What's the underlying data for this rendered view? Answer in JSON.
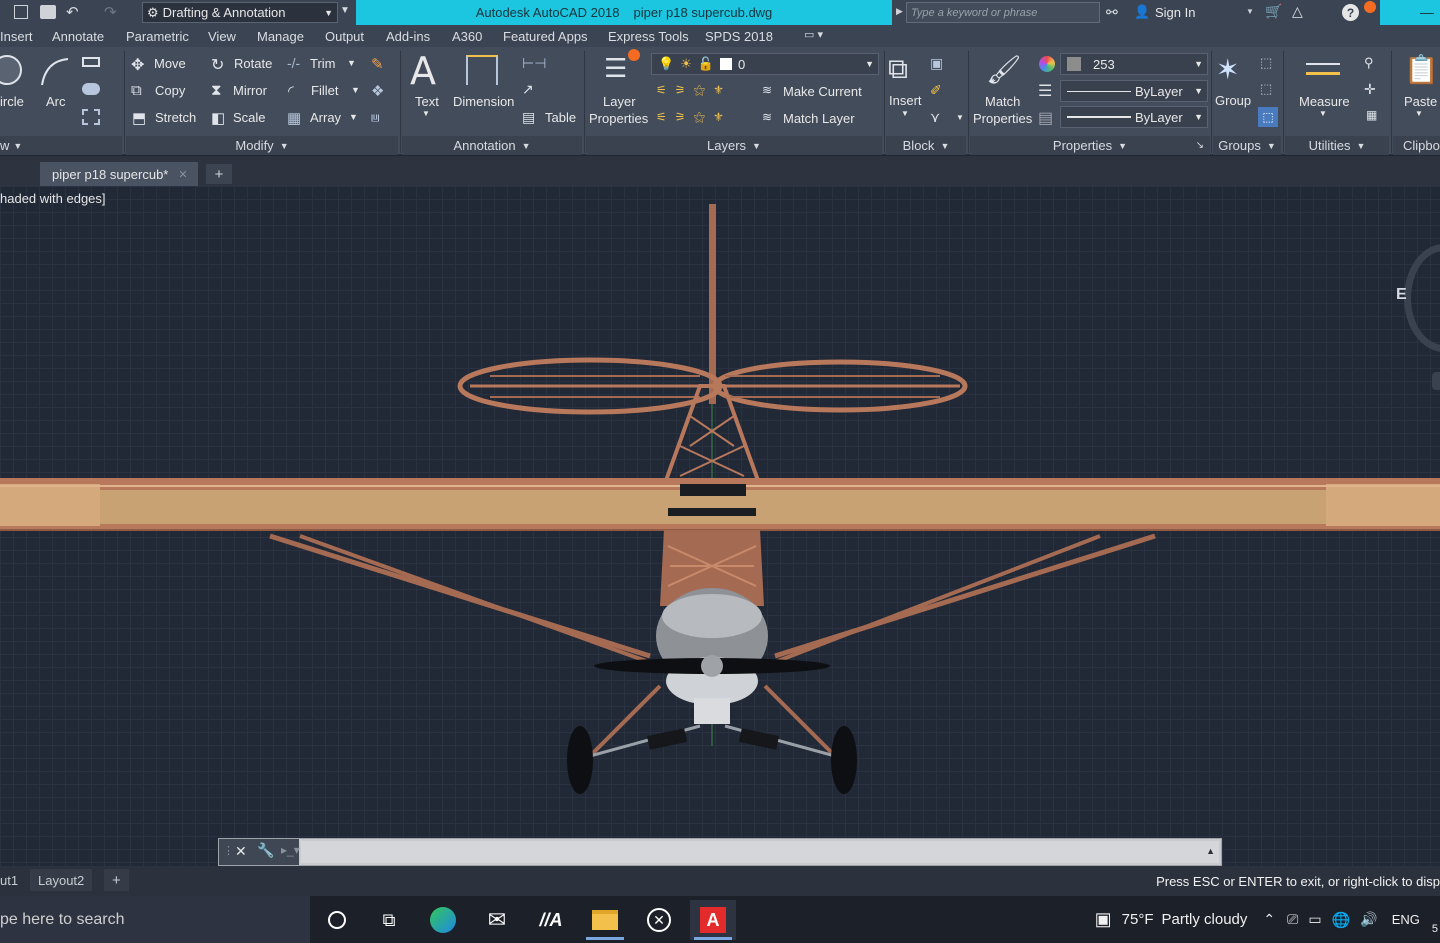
{
  "titlebar": {
    "workspace": "Drafting & Annotation",
    "app_title": "Autodesk AutoCAD 2018",
    "file_title": "piper p18 supercub.dwg",
    "search_placeholder": "Type a keyword or phrase",
    "sign_in": "Sign In"
  },
  "menu_tabs": [
    "Insert",
    "Annotate",
    "Parametric",
    "View",
    "Manage",
    "Output",
    "Add-ins",
    "A360",
    "Featured Apps",
    "Express Tools",
    "SPDS 2018"
  ],
  "ribbon": {
    "draw": {
      "circle": "ircle",
      "arc": "Arc",
      "panel": "w"
    },
    "modify": {
      "move": "Move",
      "rotate": "Rotate",
      "trim": "Trim",
      "copy": "Copy",
      "mirror": "Mirror",
      "fillet": "Fillet",
      "stretch": "Stretch",
      "scale": "Scale",
      "array": "Array",
      "panel": "Modify"
    },
    "annotation": {
      "text": "Text",
      "dimension": "Dimension",
      "table": "Table",
      "panel": "Annotation"
    },
    "layers": {
      "layer_properties_1": "Layer",
      "layer_properties_2": "Properties",
      "layer_value": "0",
      "make_current": "Make Current",
      "match_layer": "Match Layer",
      "panel": "Layers"
    },
    "block": {
      "insert": "Insert",
      "panel": "Block"
    },
    "properties": {
      "match_1": "Match",
      "match_2": "Properties",
      "color_value": "253",
      "linetype": "ByLayer",
      "lineweight": "ByLayer",
      "panel": "Properties"
    },
    "groups": {
      "group": "Group",
      "panel": "Groups"
    },
    "utilities": {
      "measure": "Measure",
      "panel": "Utilities"
    },
    "clipboard": {
      "paste": "Paste",
      "panel": "Clipbo"
    }
  },
  "file_tab": {
    "name": "piper p18 supercub*"
  },
  "viewport": {
    "label": "haded with edges]"
  },
  "layout_tabs": [
    "ut1",
    "Layout2"
  ],
  "status_message": "Press ESC or ENTER to exit, or right-click to disp",
  "taskbar": {
    "search": "pe here to search",
    "weather_temp": "75°F",
    "weather_text": "Partly cloudy",
    "lang": "ENG"
  },
  "colors": {
    "accent_cyan": "#1dc6e0",
    "frame": "#b8785c",
    "wing": "#c9a274"
  }
}
